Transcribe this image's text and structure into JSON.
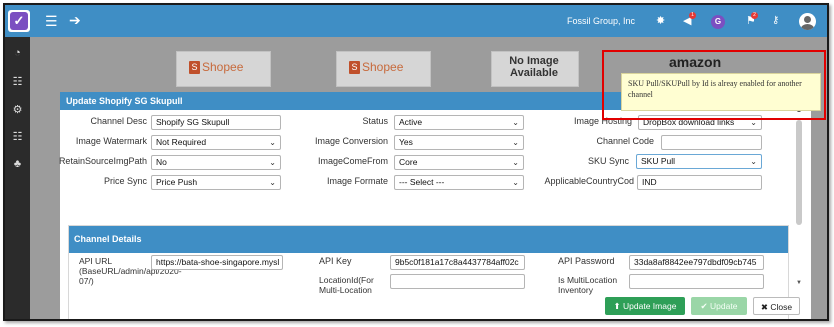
{
  "topbar": {
    "company": "Fossil Group, Inc",
    "avatar_letter": "G",
    "notification_counts": {
      "bell": "1",
      "flag": "2"
    }
  },
  "background": {
    "store_logos": [
      "Shopee",
      "Shopee"
    ],
    "no_image_line1": "No Image",
    "no_image_line2": "Available",
    "amazon_logo": "amazon"
  },
  "modal": {
    "title": "Update Shopify SG Skupull",
    "form": {
      "channel_desc": {
        "label": "Channel Desc",
        "value": "Shopify SG Skupull"
      },
      "status": {
        "label": "Status",
        "value": "Active"
      },
      "image_hosting": {
        "label": "Image Hosting",
        "value": "DropBox download links"
      },
      "image_watermark": {
        "label": "Image Watermark",
        "value": "Not Required"
      },
      "image_conversion": {
        "label": "Image Conversion",
        "value": "Yes"
      },
      "channel_code": {
        "label": "Channel Code",
        "value": ""
      },
      "retain_source": {
        "label": "RetainSourceImgPath",
        "value": "No"
      },
      "image_come_from": {
        "label": "ImageComeFrom",
        "value": "Core"
      },
      "sku_sync": {
        "label": "SKU Sync",
        "value": "SKU Pull"
      },
      "price_sync": {
        "label": "Price Sync",
        "value": "Price Push"
      },
      "image_formate": {
        "label": "Image Formate",
        "value": "--- Select ---"
      },
      "applicable_country": {
        "label": "ApplicableCountryCod",
        "value": "IND"
      }
    },
    "channel_details": {
      "title": "Channel Details",
      "api_url": {
        "label_line1": "API URL",
        "label_line2": "(BaseURL/admin/api/2020-",
        "label_line3": "07/)",
        "value": "https://bata-shoe-singapore.mysl"
      },
      "api_key": {
        "label": "API Key",
        "value": "9b5c0f181a17c8a4437784aff02c"
      },
      "api_password": {
        "label": "API Password",
        "value": "33da8af8842ee797dbdf09cb745"
      },
      "location_id": {
        "label_line1": "LocationId(For",
        "label_line2": "Multi-Location",
        "value": ""
      },
      "is_multi_location": {
        "label_line1": "Is MultiLocation",
        "label_line2": "Inventory",
        "value": ""
      }
    },
    "buttons": {
      "upload_image": "Update Image",
      "update": "Update",
      "close": "Close"
    }
  },
  "tooltip": {
    "message": "SKU Pull/SKUPull by Id is alreay enabled for another channel"
  },
  "colors": {
    "primary": "#3f8ec5",
    "sidebar": "#2b2b2b",
    "success": "#2e9f57",
    "highlight": "#e10000",
    "tooltip_bg": "#fffed2"
  }
}
